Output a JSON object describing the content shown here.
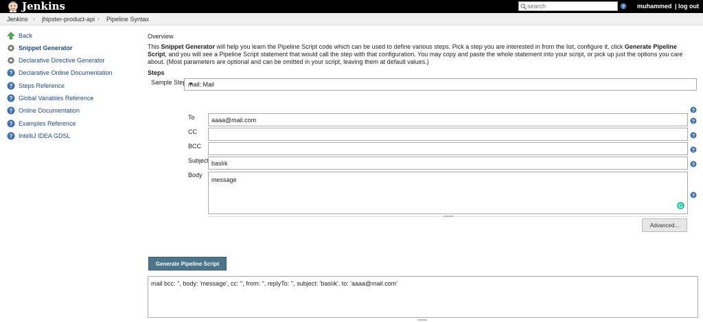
{
  "header": {
    "brand": "Jenkins",
    "search_placeholder": "search",
    "user": "muhammed",
    "logout": "| log out"
  },
  "breadcrumb": [
    "Jenkins",
    "jhipster-product-api",
    "Pipeline Syntax"
  ],
  "sidebar": {
    "items": [
      {
        "label": "Back",
        "icon": "up-arrow-icon"
      },
      {
        "label": "Snippet Generator",
        "icon": "gear-icon"
      },
      {
        "label": "Declarative Directive Generator",
        "icon": "gear-icon"
      },
      {
        "label": "Declarative Online Documentation",
        "icon": "help-icon"
      },
      {
        "label": "Steps Reference",
        "icon": "help-icon"
      },
      {
        "label": "Global Variables Reference",
        "icon": "help-icon"
      },
      {
        "label": "Online Documentation",
        "icon": "help-icon"
      },
      {
        "label": "Examples Reference",
        "icon": "help-icon"
      },
      {
        "label": "IntelliJ IDEA GDSL",
        "icon": "help-icon"
      }
    ]
  },
  "main": {
    "overview_heading": "Overview",
    "intro": {
      "part1": "This ",
      "bold1": "Snippet Generator",
      "part2": " will help you learn the Pipeline Script code which can be used to define various steps. Pick a step you are interested in from the list, configure it, click ",
      "bold2": "Generate Pipeline Script",
      "part3": ", and you will see a Pipeline Script statement that would call the step with that configuration. You may copy and paste the whole statement into your script, or pick up just the options you care about. (Most parameters are optional and can be omitted in your script, leaving them at default values.)"
    },
    "steps_heading": "Steps",
    "sample_step_label": "Sample Step",
    "sample_step_value": "mail: Mail",
    "fields": {
      "to": {
        "label": "To",
        "value": "aaaa@mail.com"
      },
      "cc": {
        "label": "CC",
        "value": ""
      },
      "bcc": {
        "label": "BCC",
        "value": ""
      },
      "subject": {
        "label": "Subject",
        "value": "baslık"
      },
      "body": {
        "label": "Body",
        "value": "message"
      }
    },
    "advanced_button": "Advanced...",
    "generate_button": "Generate Pipeline Script",
    "output": "mail bcc: '', body: 'message', cc: '', from: '', replyTo: '', subject: 'baslık', to: 'aaaa@mail.com'"
  },
  "colors": {
    "header_bg": "#000000",
    "link": "#204a87",
    "generate_button": "#4b758b"
  }
}
